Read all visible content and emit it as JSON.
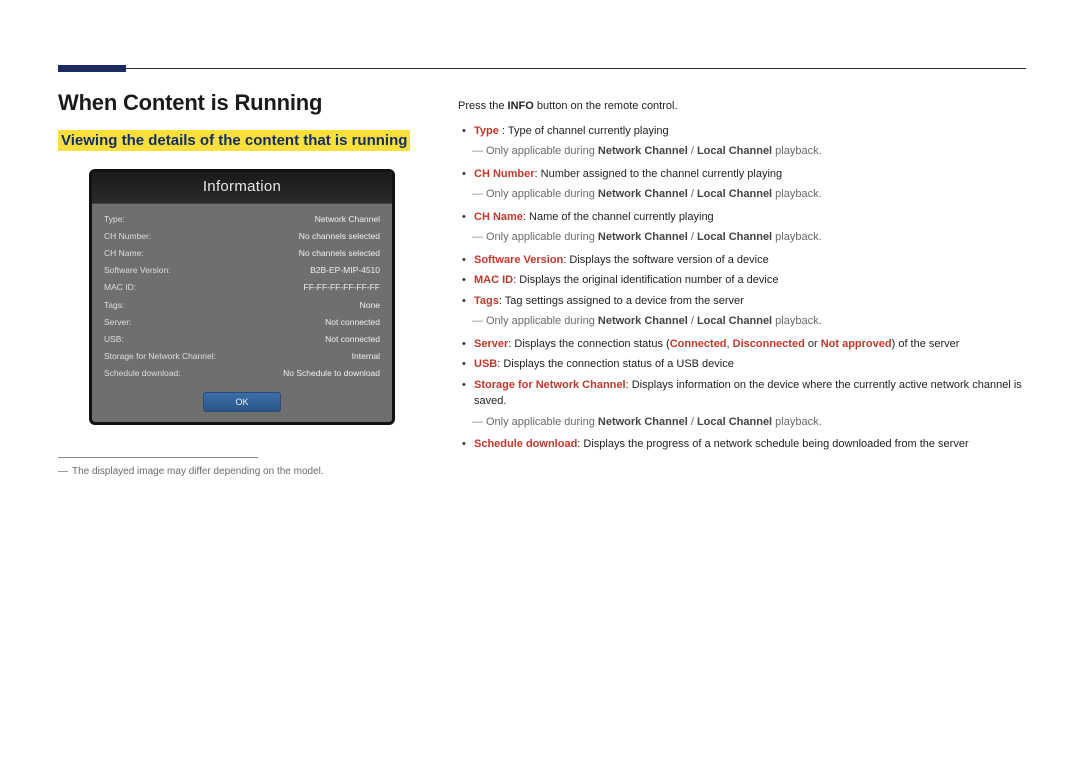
{
  "heading": "When Content is Running",
  "subheading": "Viewing the details of the content that is running",
  "info_panel": {
    "title": "Information",
    "rows": [
      {
        "k": "Type:",
        "v": "Network Channel"
      },
      {
        "k": "CH Number:",
        "v": "No channels selected"
      },
      {
        "k": "CH Name:",
        "v": "No channels selected"
      },
      {
        "k": "Software Version:",
        "v": "B2B-EP-MIP-4510"
      },
      {
        "k": "MAC ID:",
        "v": "FF-FF-FF-FF-FF-FF"
      },
      {
        "k": "Tags:",
        "v": "None"
      },
      {
        "k": "Server:",
        "v": "Not connected"
      },
      {
        "k": "USB:",
        "v": "Not connected"
      },
      {
        "k": "Storage for Network Channel:",
        "v": "Internal"
      },
      {
        "k": "Schedule download:",
        "v": "No Schedule to download"
      }
    ],
    "ok": "OK"
  },
  "footnote": "The displayed image may differ depending on the model.",
  "intro_pre": "Press the ",
  "intro_bold": "INFO",
  "intro_post": " button on the remote control.",
  "items": [
    {
      "label": "Type ",
      "desc": ": Type of channel currently playing",
      "sub": true
    },
    {
      "label": "CH Number",
      "desc": ": Number assigned to the channel currently playing",
      "sub": true
    },
    {
      "label": "CH Name",
      "desc": ": Name of the channel currently playing",
      "sub": true
    },
    {
      "label": "Software Version",
      "desc": ": Displays the software version of a device",
      "sub": false
    },
    {
      "label": "MAC ID",
      "desc": ": Displays the original identification number of a device",
      "sub": false
    },
    {
      "label": "Tags",
      "desc": ": Tag settings assigned to a device from the server",
      "sub": true
    },
    {
      "label": "Server",
      "desc_parts": [
        ": Displays the connection status (",
        {
          "b": "Connected"
        },
        ", ",
        {
          "b": "Disconnected"
        },
        " or ",
        {
          "b": "Not approved"
        },
        ") of the server"
      ],
      "sub": false
    },
    {
      "label": "USB",
      "desc": ": Displays the connection status of a USB device",
      "sub": false
    },
    {
      "label": "Storage for Network Channel",
      "desc": ": Displays information on the device where the currently active network channel is saved.",
      "sub": true
    },
    {
      "label": "Schedule download",
      "desc": ": Displays the progress of a network schedule being downloaded from the server",
      "sub": false
    }
  ],
  "sub_text_pre": "Only applicable during ",
  "sub_b1": "Network Channel",
  "sub_sep": " / ",
  "sub_b2": "Local Channel",
  "sub_text_post": " playback."
}
